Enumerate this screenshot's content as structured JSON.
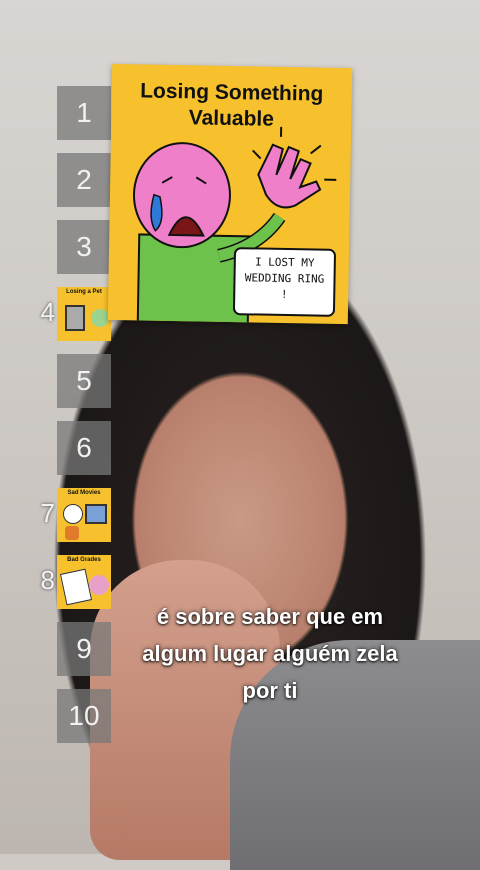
{
  "ladder": {
    "slots": [
      {
        "rank": "1"
      },
      {
        "rank": "2"
      },
      {
        "rank": "3"
      },
      {
        "rank": "4",
        "thumb_title": "Losing a Pet"
      },
      {
        "rank": "5"
      },
      {
        "rank": "6"
      },
      {
        "rank": "7",
        "thumb_title": "Sad Movies"
      },
      {
        "rank": "8",
        "thumb_title": "Bad Grades"
      },
      {
        "rank": "9"
      },
      {
        "rank": "10"
      }
    ]
  },
  "card": {
    "title": "Losing Something Valuable",
    "speech": "I LOST MY WEDDING RING !"
  },
  "caption": {
    "lines": [
      "é sobre saber que em",
      "algum lugar alguém zela",
      "por ti"
    ]
  },
  "colors": {
    "card_bg": "#f6c12c",
    "slot_bg": "#7a7a7a"
  }
}
